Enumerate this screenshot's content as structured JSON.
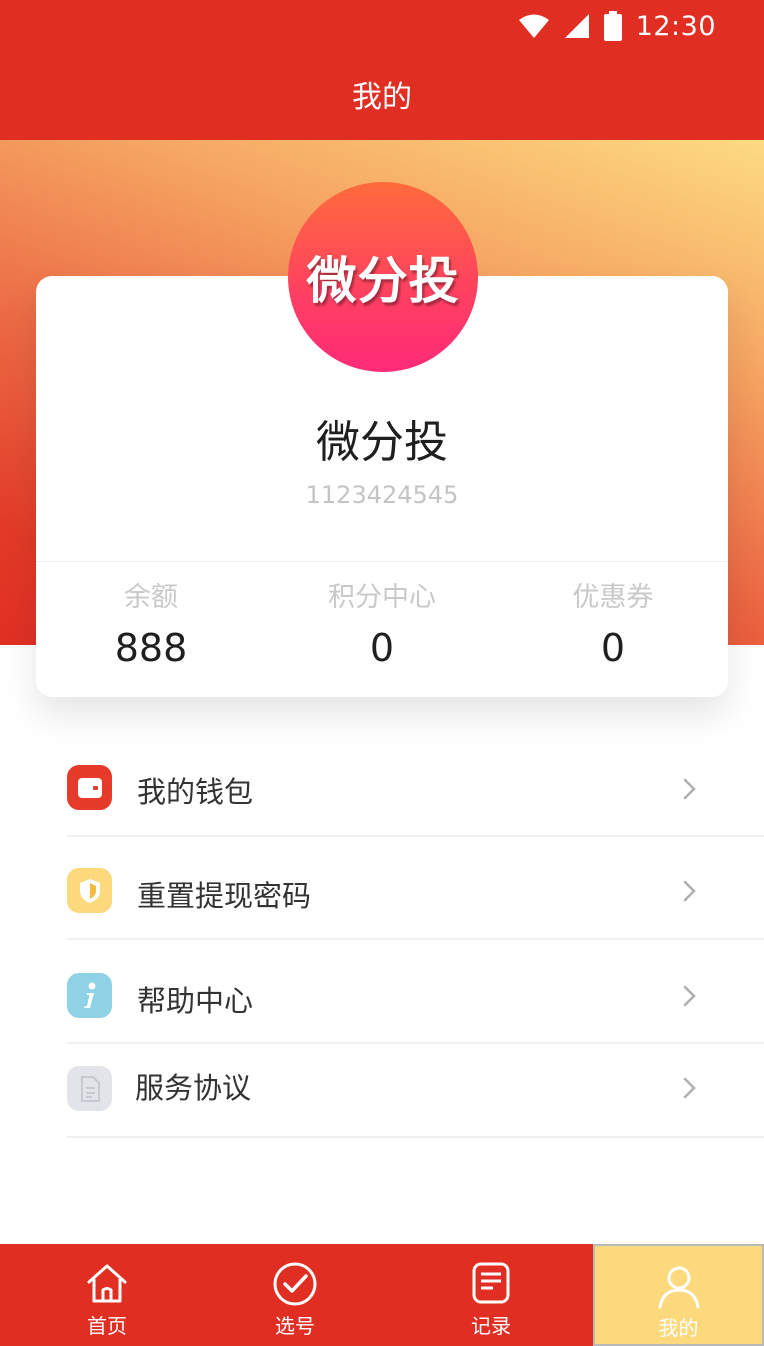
{
  "status_bar": {
    "time": "12:30",
    "icons": [
      "wifi-icon",
      "signal-icon",
      "battery-icon"
    ]
  },
  "header": {
    "title": "我的"
  },
  "profile": {
    "avatar_text": "微分投",
    "name": "微分投",
    "user_id": "1123424545"
  },
  "stats": [
    {
      "label": "余额",
      "value": "888"
    },
    {
      "label": "积分中心",
      "value": "0"
    },
    {
      "label": "优惠券",
      "value": "0"
    }
  ],
  "menu": [
    {
      "label": "我的钱包",
      "icon": "wallet-icon",
      "color": "#e63a2b"
    },
    {
      "label": "重置提现密码",
      "icon": "shield-icon",
      "color": "#fdd97d"
    },
    {
      "label": "帮助中心",
      "icon": "info-icon",
      "color": "#8fd2e6"
    },
    {
      "label": "服务协议",
      "icon": "document-icon",
      "color": "#e3e3ea"
    }
  ],
  "tabs": [
    {
      "label": "首页",
      "icon": "home-icon"
    },
    {
      "label": "选号",
      "icon": "check-circle-icon"
    },
    {
      "label": "记录",
      "icon": "list-doc-icon"
    },
    {
      "label": "我的",
      "icon": "user-icon",
      "active": true
    }
  ],
  "colors": {
    "primary": "#e12e23",
    "accent": "#fdd97d",
    "avatar_gradient": [
      "#ff6b3c",
      "#ff2a78"
    ]
  }
}
